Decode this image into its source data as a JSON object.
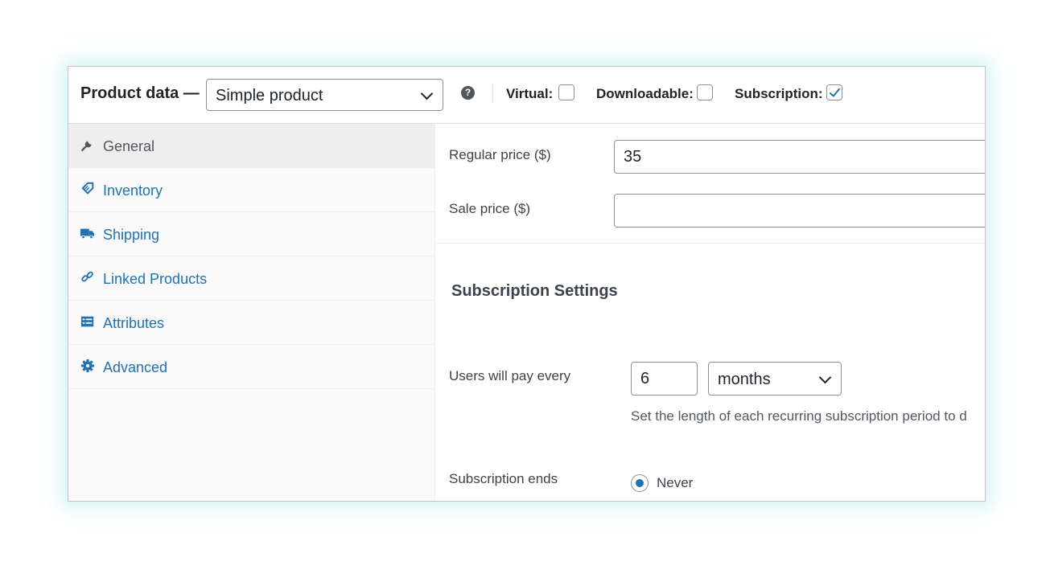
{
  "header": {
    "title": "Product data —",
    "product_type": {
      "selected": "Simple product"
    },
    "help_icon": "question-circle-icon",
    "options": {
      "virtual": {
        "label": "Virtual:",
        "checked": false
      },
      "downloadable": {
        "label": "Downloadable:",
        "checked": false
      },
      "subscription": {
        "label": "Subscription:",
        "checked": true
      }
    }
  },
  "sidebar": {
    "items": [
      {
        "label": "General",
        "icon": "wrench-icon",
        "active": true
      },
      {
        "label": "Inventory",
        "icon": "tag-icon",
        "active": false
      },
      {
        "label": "Shipping",
        "icon": "truck-icon",
        "active": false
      },
      {
        "label": "Linked Products",
        "icon": "link-icon",
        "active": false
      },
      {
        "label": "Attributes",
        "icon": "list-icon",
        "active": false
      },
      {
        "label": "Advanced",
        "icon": "gear-icon",
        "active": false
      }
    ]
  },
  "general": {
    "regular_price": {
      "label": "Regular price ($)",
      "value": "35"
    },
    "sale_price": {
      "label": "Sale price ($)",
      "value": ""
    }
  },
  "subscription": {
    "title": "Subscription Settings",
    "pay_every": {
      "label": "Users will pay every",
      "interval": "6",
      "period": "months",
      "help": "Set the length of each recurring subscription period to d"
    },
    "ends": {
      "label": "Subscription ends",
      "option": "Never",
      "selected": true
    }
  },
  "colors": {
    "link": "#2271b1",
    "active_nav_text": "#50575e",
    "sidebar_bg": "#fafafa",
    "active_nav_bg": "#eeeeee",
    "glow": "#b4ebf0"
  }
}
